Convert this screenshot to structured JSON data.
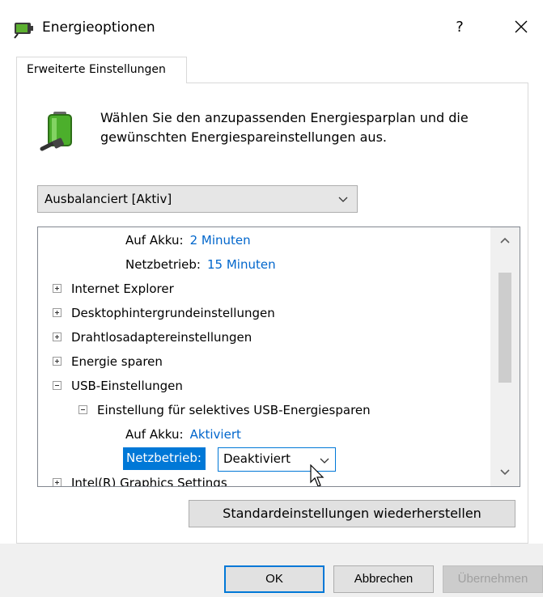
{
  "window": {
    "title": "Energieoptionen",
    "help_label": "?",
    "icons": {
      "app": "power-options-icon",
      "close": "close-icon"
    }
  },
  "tabs": [
    {
      "label": "Erweiterte Einstellungen",
      "active": true
    }
  ],
  "intro": {
    "text": "Wählen Sie den anzupassenden Energiesparplan und die gewünschten Energiespareinstellungen aus.",
    "icon": "battery-plug-icon"
  },
  "plan_select": {
    "value": "Ausbalanciert [Aktiv]"
  },
  "settings_tree": {
    "items": [
      {
        "type": "setting",
        "label": "Auf Akku:",
        "value": "2 Minuten"
      },
      {
        "type": "setting",
        "label": "Netzbetrieb:",
        "value": "15 Minuten"
      },
      {
        "type": "group",
        "label": "Internet Explorer",
        "expanded": false
      },
      {
        "type": "group",
        "label": "Desktophintergrundeinstellungen",
        "expanded": false
      },
      {
        "type": "group",
        "label": "Drahtlosadaptereinstellungen",
        "expanded": false
      },
      {
        "type": "group",
        "label": "Energie sparen",
        "expanded": false
      },
      {
        "type": "group",
        "label": "USB-Einstellungen",
        "expanded": true
      },
      {
        "type": "group",
        "label": "Einstellung für selektives USB-Energiesparen",
        "expanded": true
      },
      {
        "type": "setting",
        "label": "Auf Akku:",
        "value": "Aktiviert"
      },
      {
        "type": "setting",
        "label": "Netzbetrieb:",
        "value": "Deaktiviert",
        "selected": true,
        "editing": true
      },
      {
        "type": "group",
        "label": "Intel(R) Graphics Settings",
        "expanded": false
      }
    ]
  },
  "buttons": {
    "restore": "Standardeinstellungen wiederherstellen",
    "ok": "OK",
    "cancel": "Abbrechen",
    "apply": "Übernehmen"
  },
  "colors": {
    "accent": "#0078d7",
    "link_value": "#0066cc",
    "disabled_text": "#a0a0a0"
  }
}
